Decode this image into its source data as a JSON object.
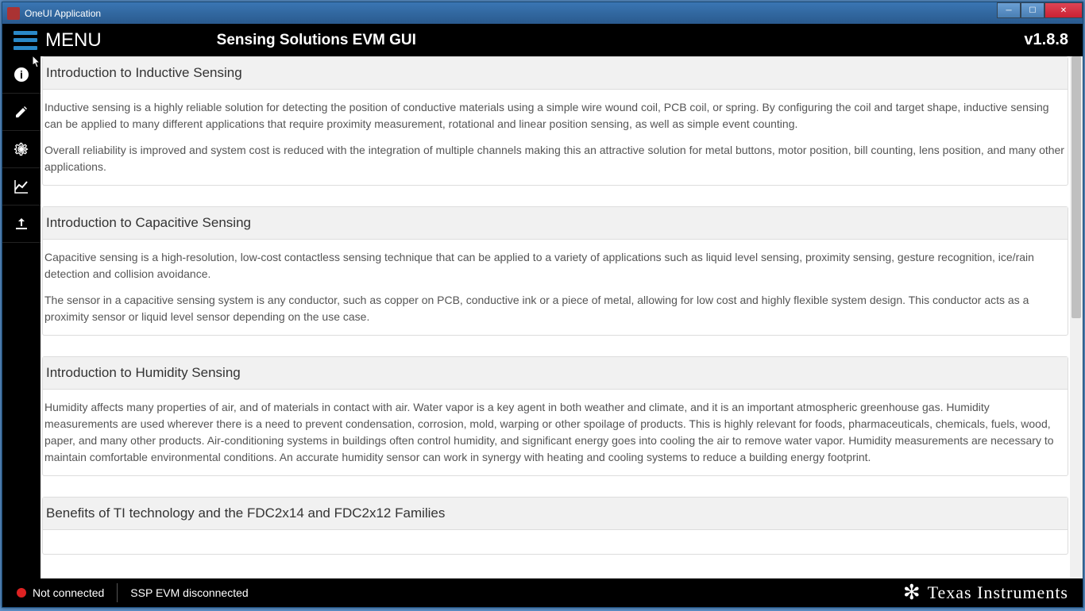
{
  "window": {
    "title": "OneUI Application"
  },
  "header": {
    "menu_label": "MENU",
    "title": "Sensing Solutions EVM GUI",
    "version": "v1.8.8"
  },
  "sidebar": {
    "items": [
      {
        "name": "info-icon",
        "glyph": "ℹ"
      },
      {
        "name": "edit-icon",
        "glyph": "✎"
      },
      {
        "name": "gear-icon",
        "glyph": "⚙"
      },
      {
        "name": "chart-icon",
        "glyph": "📈"
      },
      {
        "name": "upload-icon",
        "glyph": "⬆"
      }
    ]
  },
  "sections": [
    {
      "title": "Introduction to Inductive Sensing",
      "paragraphs": [
        "Inductive sensing is a highly reliable solution for detecting the position of conductive materials using a simple wire wound coil, PCB coil, or spring. By configuring the coil and target shape, inductive sensing can be applied to many different applications that require proximity measurement, rotational and linear position sensing, as well as simple event counting.",
        "Overall reliability is improved and system cost is reduced with the integration of multiple channels making this an attractive solution for metal buttons, motor position, bill counting, lens position, and many other applications."
      ]
    },
    {
      "title": "Introduction to Capacitive Sensing",
      "paragraphs": [
        "Capacitive sensing is a high-resolution, low-cost contactless sensing technique that can be applied to a variety of applications such as liquid level sensing, proximity sensing, gesture recognition, ice/rain detection and collision avoidance.",
        "The sensor in a capacitive sensing system is any conductor, such as copper on PCB, conductive ink or a piece of metal, allowing for low cost and highly flexible system design. This conductor acts as a proximity sensor or liquid level sensor depending on the use case."
      ]
    },
    {
      "title": "Introduction to Humidity Sensing",
      "paragraphs": [
        "Humidity affects many properties of air, and of materials in contact with air. Water vapor is a key agent in both weather and climate, and it is an important atmospheric greenhouse gas. Humidity measurements are used wherever there is a need to prevent condensation, corrosion, mold, warping or other spoilage of products. This is highly relevant for foods, pharmaceuticals, chemicals, fuels, wood, paper, and many other products. Air-conditioning systems in buildings often control humidity, and significant energy goes into cooling the air to remove water vapor. Humidity measurements are necessary to maintain comfortable environmental conditions. An accurate humidity sensor can work in synergy with heating and cooling systems to reduce a building energy footprint."
      ]
    },
    {
      "title": "Benefits of TI technology and the FDC2x14 and FDC2x12 Families",
      "paragraphs": []
    }
  ],
  "status": {
    "connection": "Not connected",
    "device": "SSP EVM disconnected",
    "brand": "Texas Instruments"
  }
}
